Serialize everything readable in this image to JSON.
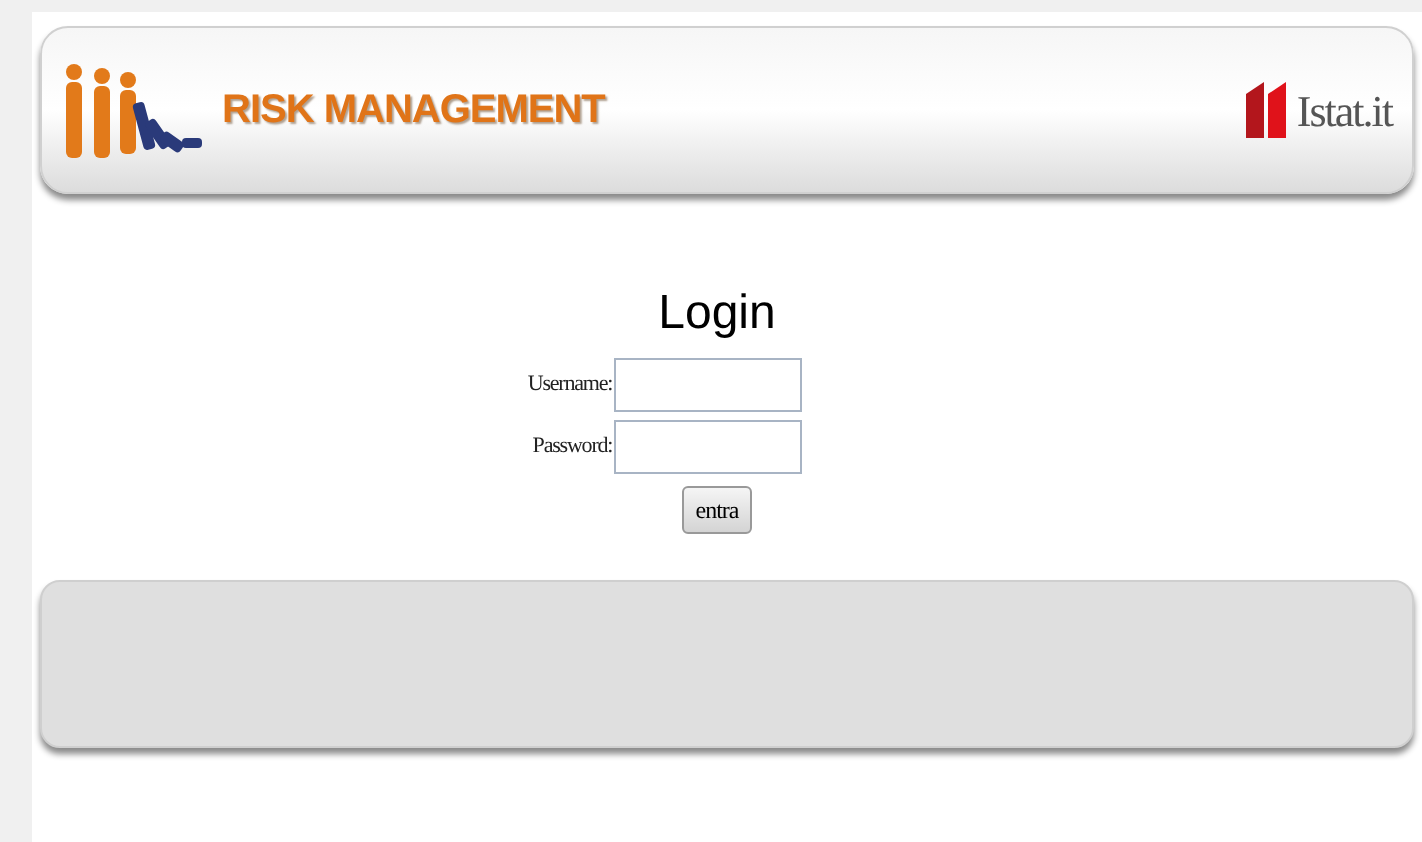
{
  "header": {
    "title": "RISK MANAGEMENT",
    "brand": "Istat.it"
  },
  "login": {
    "heading": "Login",
    "fields": [
      {
        "label": "Username:"
      },
      {
        "label": "Password:"
      }
    ],
    "submit": "entra"
  }
}
